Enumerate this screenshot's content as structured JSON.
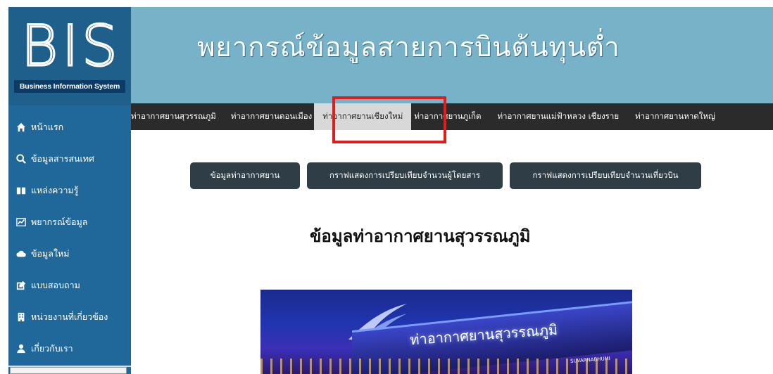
{
  "logo": {
    "letters": [
      "B",
      "I",
      "S"
    ],
    "tagline": "Business Information System"
  },
  "banner": {
    "title": "พยากรณ์ข้อมูลสายการบินต้นทุนต่ำ"
  },
  "sidebar": {
    "items": [
      {
        "label": "หน้าแรก",
        "icon": "home-icon"
      },
      {
        "label": "ข้อมูลสารสนเทศ",
        "icon": "search-icon"
      },
      {
        "label": "แหล่งความรู้",
        "icon": "book-icon"
      },
      {
        "label": "พยากรณ์ข้อมูล",
        "icon": "chart-icon"
      },
      {
        "label": "ข้อมูลใหม่",
        "icon": "cloud-icon"
      },
      {
        "label": "แบบสอบถาม",
        "icon": "edit-icon"
      },
      {
        "label": "หน่วยงานที่เกี่ยวข้อง",
        "icon": "building-icon"
      },
      {
        "label": "เกี่ยวกับเรา",
        "icon": "user-icon"
      }
    ]
  },
  "topnav": {
    "items": [
      "ท่าอากาศยานสุวรรณภูมิ",
      "ท่าอากาศยานดอนเมือง",
      "ท่าอากาศยานเชียงใหม่",
      "ท่าอากาศยานภูเก็ต",
      "ท่าอากาศยานแม่ฟ้าหลวง เชียงราย",
      "ท่าอากาศยานหาดใหญ่"
    ],
    "active_index": 2
  },
  "buttons": {
    "airport_info": "ข้อมูลท่าอากาศยาน",
    "passenger_chart": "กราฟแสดงการเปรียบเทียบจำนวนผู้โดยสาร",
    "flight_chart": "กราฟแสดงการเปรียบเทียบจำนวนเที่ยวบิน"
  },
  "content": {
    "heading": "ข้อมูลท่าอากาศยานสุวรรณภูมิ",
    "photo_sign": "ท่าอากาศยานสุวรรณภูมิ",
    "photo_sign_en": "SUVARNABHUMI"
  },
  "colors": {
    "sidebar": "#20689a",
    "banner": "#78b2c8",
    "topnav": "#2b2b2b",
    "button": "#2f3d47",
    "highlight": "#e21b1b"
  }
}
